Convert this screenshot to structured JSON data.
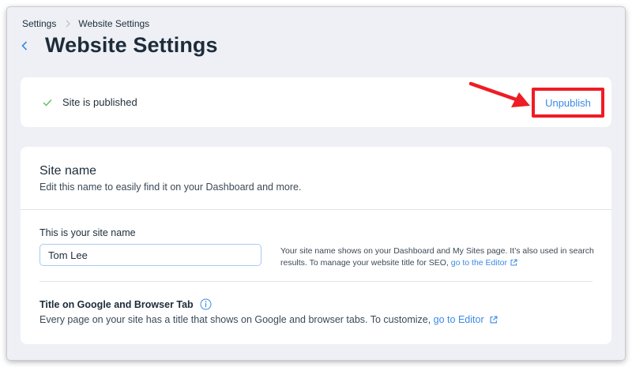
{
  "breadcrumb": {
    "parent": "Settings",
    "current": "Website Settings"
  },
  "page_title": "Website Settings",
  "status": {
    "text": "Site is published",
    "action_label": "Unpublish"
  },
  "site_name": {
    "title": "Site name",
    "description": "Edit this name to easily find it on your Dashboard and more.",
    "field_label": "This is your site name",
    "field_value": "Tom Lee",
    "help_text": "Your site name shows on your Dashboard and My Sites page. It’s also used in search results. To manage your website title for SEO,",
    "help_link": "go to the Editor"
  },
  "google_tab": {
    "title": "Title on Google and Browser Tab",
    "description": "Every page on your site has a title that shows on Google and browser tabs. To customize,",
    "link": "go to Editor"
  },
  "colors": {
    "accent": "#3b8ae6",
    "highlight": "#ee1c25",
    "success": "#60bc57"
  },
  "icons": [
    "chevron-right-icon",
    "back-chevron-icon",
    "check-icon",
    "external-link-icon",
    "info-icon",
    "red-arrow-annotation"
  ]
}
